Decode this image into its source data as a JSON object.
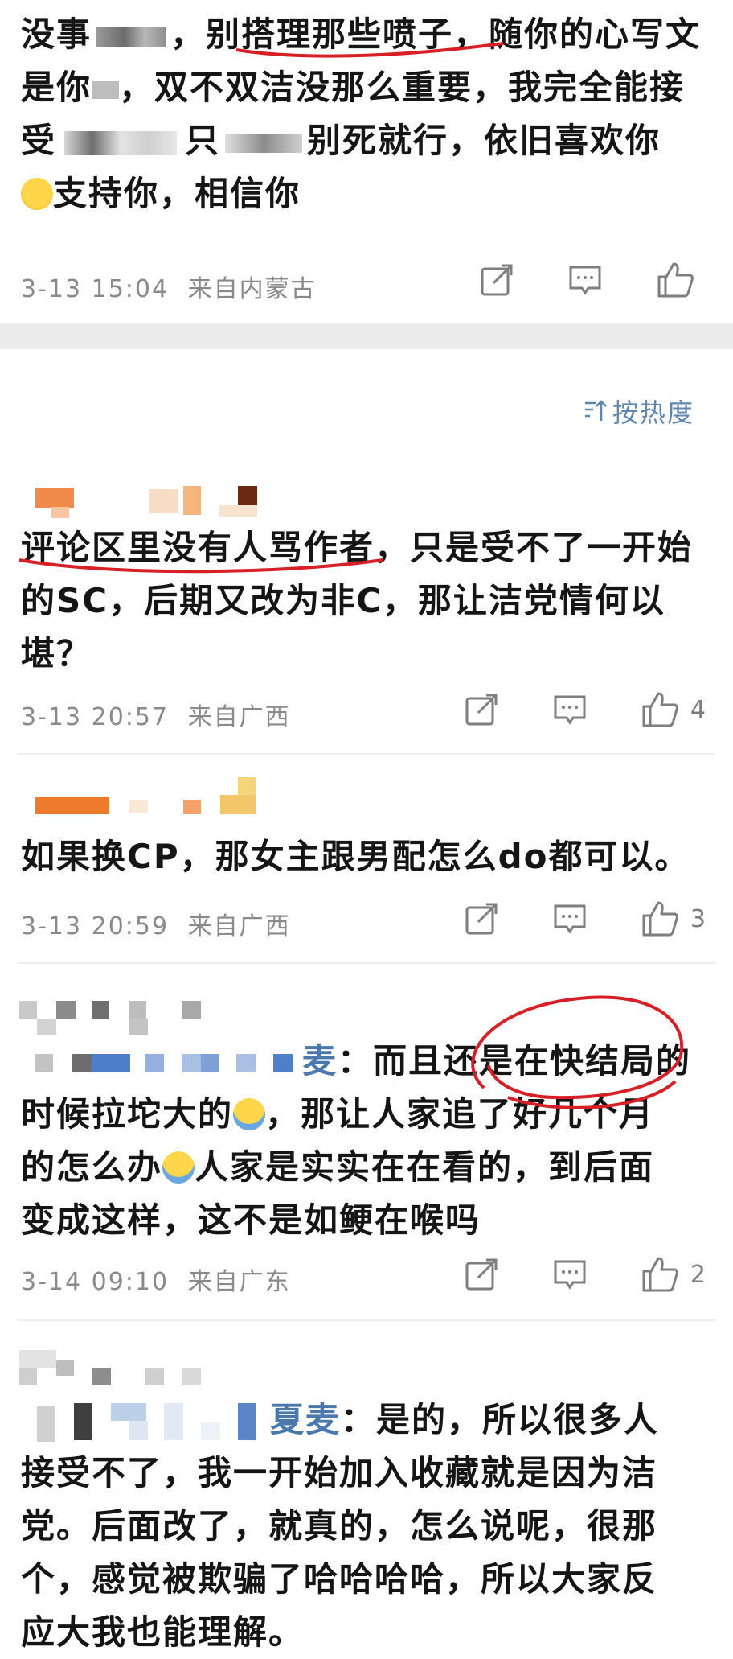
{
  "sort": {
    "label": "按热度"
  },
  "comments": [
    {
      "text_a": "没事",
      "text_b": "，别搭理那些喷子，随你的心写文",
      "text_c": "是你",
      "text_d": "，双不双洁没那么重要，我完全能接",
      "text_e": "受",
      "text_f": "只",
      "text_g": "别死就行，依旧喜欢你",
      "text_h": "支持你，相信你",
      "time": "3-13 15:04",
      "location": "来自内蒙古",
      "likes": ""
    },
    {
      "text": "评论区里没有人骂作者，只是受不了一开始的SC，后期又改为非C，那让洁党情何以堪？",
      "time": "3-13 20:57",
      "location": "来自广西",
      "likes": "4"
    },
    {
      "text": "如果换CP，那女主跟男配怎么do都可以。",
      "time": "3-13 20:59",
      "location": "来自广西",
      "likes": "3"
    },
    {
      "reply_name": "麦",
      "text_a": "：而且还是在快结局的",
      "text_b": "时候拉坨大的",
      "text_c": "，那让人家追了好几个月",
      "text_d": "的怎么办",
      "text_e": "人家是实实在在看的，到后面",
      "text_f": "变成这样，这不是如鲠在喉吗",
      "time": "3-14 09:10",
      "location": "来自广东",
      "likes": "2"
    },
    {
      "reply_name": "夏麦",
      "text_a": "：是的，所以很多人",
      "text_b": "接受不了，我一开始加入收藏就是因为洁",
      "text_c": "党。后面改了，就真的，怎么说呢，很那",
      "text_d": "个，感觉被欺骗了哈哈哈哈，所以大家反",
      "text_e": "应大我也能理解。"
    }
  ],
  "icons": [
    "share-icon",
    "comment-icon",
    "like-icon",
    "sort-icon"
  ],
  "colors": {
    "accent": "#5d87b0",
    "red_mark": "#d81f26",
    "meta": "#8a8a8a"
  }
}
